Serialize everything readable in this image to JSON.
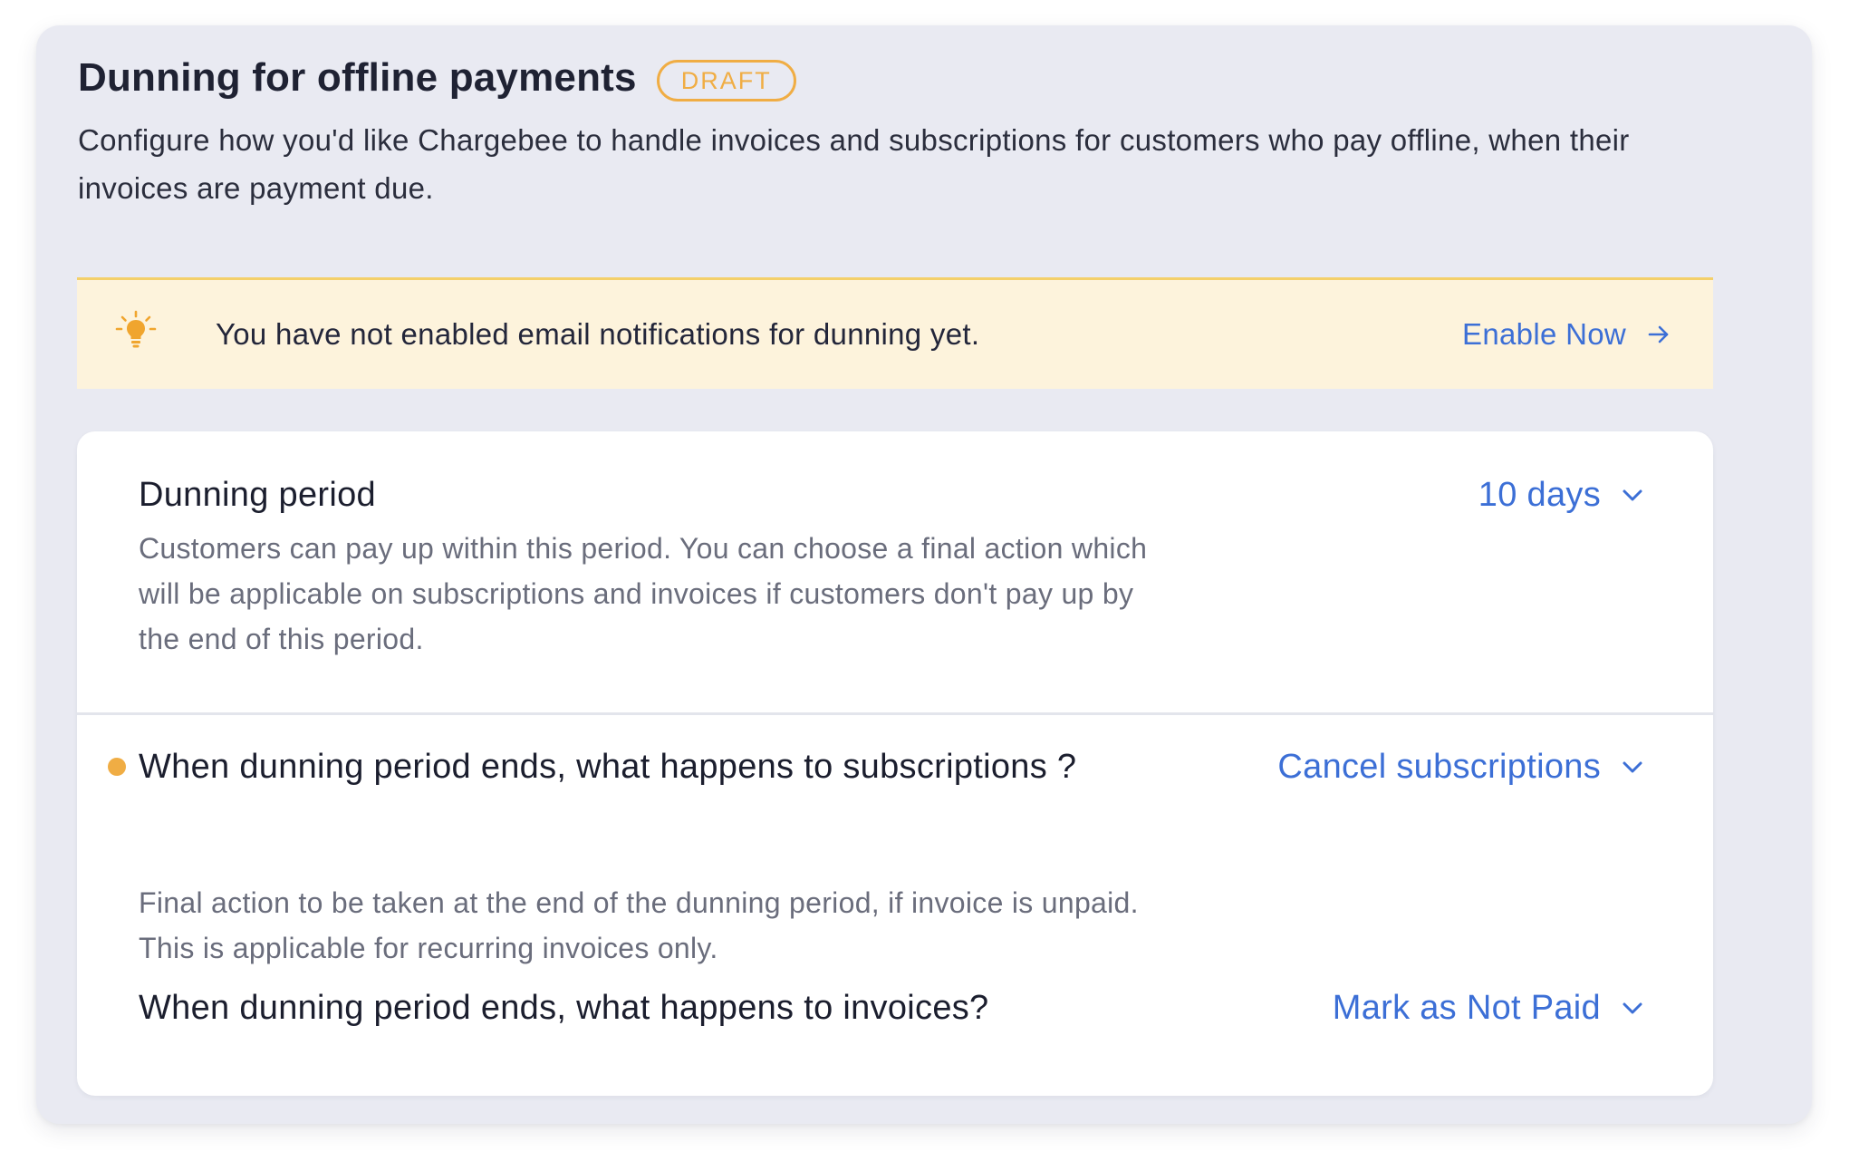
{
  "header": {
    "title": "Dunning for offline payments",
    "badge": "DRAFT",
    "description": "Configure how you'd like Chargebee to handle invoices and subscriptions for customers who pay offline, when their invoices are payment due."
  },
  "notice": {
    "icon": "lightbulb-icon",
    "text": "You have not enabled email notifications for dunning yet.",
    "action_label": "Enable Now",
    "action_icon": "arrow-right-icon"
  },
  "settings": {
    "dunning_period": {
      "title": "Dunning period",
      "description": "Customers can pay up within this period. You can choose a final action which will be applicable on subscriptions and invoices if customers don't pay up by the end of this period.",
      "value": "10 days"
    },
    "subscriptions_action": {
      "title": "When dunning period ends, what happens to subscriptions ?",
      "description": "Final action to be taken at the end of the dunning period, if invoice is unpaid. This is applicable for recurring invoices only.",
      "value": "Cancel subscriptions",
      "has_indicator": true
    },
    "invoices_action": {
      "title": "When dunning period ends, what happens to invoices?",
      "value": "Mark as Not Paid"
    }
  },
  "colors": {
    "accent_link": "#3c6fd6",
    "draft_badge": "#f0ad44",
    "notice_background": "#fdf3dc",
    "indicator_dot": "#f0ad44"
  }
}
